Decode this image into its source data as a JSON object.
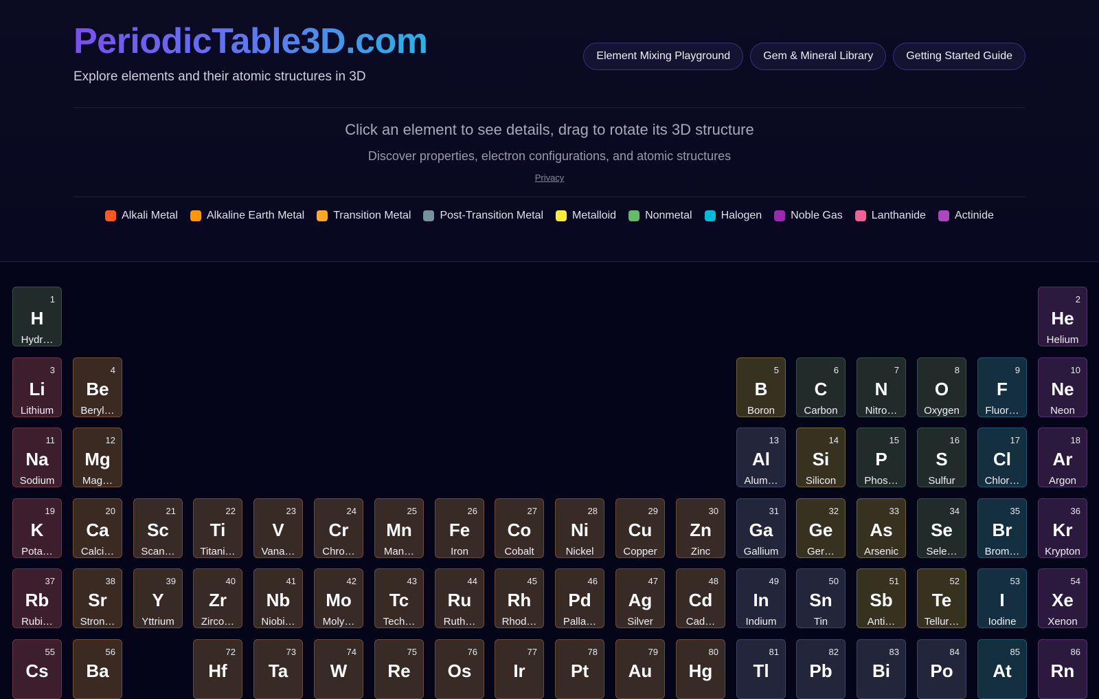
{
  "header": {
    "brand": "PeriodicTable3D.com",
    "tagline": "Explore elements and their atomic structures in 3D",
    "nav": [
      "Element Mixing Playground",
      "Gem & Mineral Library",
      "Getting Started Guide"
    ]
  },
  "instructions": {
    "main": "Click an element to see details, drag to rotate its 3D structure",
    "sub": "Discover properties, electron configurations, and atomic structures",
    "privacy": "Privacy"
  },
  "legend": [
    {
      "label": "Alkali Metal",
      "color": "#ff5722"
    },
    {
      "label": "Alkaline Earth Metal",
      "color": "#ff9800"
    },
    {
      "label": "Transition Metal",
      "color": "#ffa726"
    },
    {
      "label": "Post-Transition Metal",
      "color": "#78909c"
    },
    {
      "label": "Metalloid",
      "color": "#ffeb3b"
    },
    {
      "label": "Nonmetal",
      "color": "#66bb6a"
    },
    {
      "label": "Halogen",
      "color": "#00bcd4"
    },
    {
      "label": "Noble Gas",
      "color": "#9c27b0"
    },
    {
      "label": "Lanthanide",
      "color": "#f06292"
    },
    {
      "label": "Actinide",
      "color": "#ab47bc"
    }
  ],
  "elements": [
    {
      "n": "1",
      "s": "H",
      "name": "Hydr…",
      "cat": "nonmetal",
      "row": 0,
      "col": 0
    },
    {
      "n": "2",
      "s": "He",
      "name": "Helium",
      "cat": "noble",
      "row": 0,
      "col": 17
    },
    {
      "n": "3",
      "s": "Li",
      "name": "Lithium",
      "cat": "alkali",
      "row": 1,
      "col": 0
    },
    {
      "n": "4",
      "s": "Be",
      "name": "Beryl…",
      "cat": "alkaline",
      "row": 1,
      "col": 1
    },
    {
      "n": "5",
      "s": "B",
      "name": "Boron",
      "cat": "metalloid",
      "row": 1,
      "col": 12
    },
    {
      "n": "6",
      "s": "C",
      "name": "Carbon",
      "cat": "nonmetal",
      "row": 1,
      "col": 13
    },
    {
      "n": "7",
      "s": "N",
      "name": "Nitro…",
      "cat": "nonmetal",
      "row": 1,
      "col": 14
    },
    {
      "n": "8",
      "s": "O",
      "name": "Oxygen",
      "cat": "nonmetal",
      "row": 1,
      "col": 15
    },
    {
      "n": "9",
      "s": "F",
      "name": "Fluor…",
      "cat": "halogen",
      "row": 1,
      "col": 16
    },
    {
      "n": "10",
      "s": "Ne",
      "name": "Neon",
      "cat": "noble",
      "row": 1,
      "col": 17
    },
    {
      "n": "11",
      "s": "Na",
      "name": "Sodium",
      "cat": "alkali",
      "row": 2,
      "col": 0
    },
    {
      "n": "12",
      "s": "Mg",
      "name": "Mag…",
      "cat": "alkaline",
      "row": 2,
      "col": 1
    },
    {
      "n": "13",
      "s": "Al",
      "name": "Alum…",
      "cat": "post",
      "row": 2,
      "col": 12
    },
    {
      "n": "14",
      "s": "Si",
      "name": "Silicon",
      "cat": "metalloid",
      "row": 2,
      "col": 13
    },
    {
      "n": "15",
      "s": "P",
      "name": "Phos…",
      "cat": "nonmetal",
      "row": 2,
      "col": 14
    },
    {
      "n": "16",
      "s": "S",
      "name": "Sulfur",
      "cat": "nonmetal",
      "row": 2,
      "col": 15
    },
    {
      "n": "17",
      "s": "Cl",
      "name": "Chlor…",
      "cat": "halogen",
      "row": 2,
      "col": 16
    },
    {
      "n": "18",
      "s": "Ar",
      "name": "Argon",
      "cat": "noble",
      "row": 2,
      "col": 17
    },
    {
      "n": "19",
      "s": "K",
      "name": "Pota…",
      "cat": "alkali",
      "row": 3,
      "col": 0
    },
    {
      "n": "20",
      "s": "Ca",
      "name": "Calci…",
      "cat": "alkaline",
      "row": 3,
      "col": 1
    },
    {
      "n": "21",
      "s": "Sc",
      "name": "Scan…",
      "cat": "transition",
      "row": 3,
      "col": 2
    },
    {
      "n": "22",
      "s": "Ti",
      "name": "Titani…",
      "cat": "transition",
      "row": 3,
      "col": 3
    },
    {
      "n": "23",
      "s": "V",
      "name": "Vana…",
      "cat": "transition",
      "row": 3,
      "col": 4
    },
    {
      "n": "24",
      "s": "Cr",
      "name": "Chro…",
      "cat": "transition",
      "row": 3,
      "col": 5
    },
    {
      "n": "25",
      "s": "Mn",
      "name": "Man…",
      "cat": "transition",
      "row": 3,
      "col": 6
    },
    {
      "n": "26",
      "s": "Fe",
      "name": "Iron",
      "cat": "transition",
      "row": 3,
      "col": 7
    },
    {
      "n": "27",
      "s": "Co",
      "name": "Cobalt",
      "cat": "transition",
      "row": 3,
      "col": 8
    },
    {
      "n": "28",
      "s": "Ni",
      "name": "Nickel",
      "cat": "transition",
      "row": 3,
      "col": 9
    },
    {
      "n": "29",
      "s": "Cu",
      "name": "Copper",
      "cat": "transition",
      "row": 3,
      "col": 10
    },
    {
      "n": "30",
      "s": "Zn",
      "name": "Zinc",
      "cat": "transition",
      "row": 3,
      "col": 11
    },
    {
      "n": "31",
      "s": "Ga",
      "name": "Gallium",
      "cat": "post",
      "row": 3,
      "col": 12
    },
    {
      "n": "32",
      "s": "Ge",
      "name": "Ger…",
      "cat": "metalloid",
      "row": 3,
      "col": 13
    },
    {
      "n": "33",
      "s": "As",
      "name": "Arsenic",
      "cat": "metalloid",
      "row": 3,
      "col": 14
    },
    {
      "n": "34",
      "s": "Se",
      "name": "Sele…",
      "cat": "nonmetal",
      "row": 3,
      "col": 15
    },
    {
      "n": "35",
      "s": "Br",
      "name": "Brom…",
      "cat": "halogen",
      "row": 3,
      "col": 16
    },
    {
      "n": "36",
      "s": "Kr",
      "name": "Krypton",
      "cat": "noble",
      "row": 3,
      "col": 17
    },
    {
      "n": "37",
      "s": "Rb",
      "name": "Rubi…",
      "cat": "alkali",
      "row": 4,
      "col": 0
    },
    {
      "n": "38",
      "s": "Sr",
      "name": "Stron…",
      "cat": "alkaline",
      "row": 4,
      "col": 1
    },
    {
      "n": "39",
      "s": "Y",
      "name": "Yttrium",
      "cat": "transition",
      "row": 4,
      "col": 2
    },
    {
      "n": "40",
      "s": "Zr",
      "name": "Zirco…",
      "cat": "transition",
      "row": 4,
      "col": 3
    },
    {
      "n": "41",
      "s": "Nb",
      "name": "Niobi…",
      "cat": "transition",
      "row": 4,
      "col": 4
    },
    {
      "n": "42",
      "s": "Mo",
      "name": "Moly…",
      "cat": "transition",
      "row": 4,
      "col": 5
    },
    {
      "n": "43",
      "s": "Tc",
      "name": "Tech…",
      "cat": "transition",
      "row": 4,
      "col": 6
    },
    {
      "n": "44",
      "s": "Ru",
      "name": "Ruth…",
      "cat": "transition",
      "row": 4,
      "col": 7
    },
    {
      "n": "45",
      "s": "Rh",
      "name": "Rhod…",
      "cat": "transition",
      "row": 4,
      "col": 8
    },
    {
      "n": "46",
      "s": "Pd",
      "name": "Palla…",
      "cat": "transition",
      "row": 4,
      "col": 9
    },
    {
      "n": "47",
      "s": "Ag",
      "name": "Silver",
      "cat": "transition",
      "row": 4,
      "col": 10
    },
    {
      "n": "48",
      "s": "Cd",
      "name": "Cad…",
      "cat": "transition",
      "row": 4,
      "col": 11
    },
    {
      "n": "49",
      "s": "In",
      "name": "Indium",
      "cat": "post",
      "row": 4,
      "col": 12
    },
    {
      "n": "50",
      "s": "Sn",
      "name": "Tin",
      "cat": "post",
      "row": 4,
      "col": 13
    },
    {
      "n": "51",
      "s": "Sb",
      "name": "Anti…",
      "cat": "metalloid",
      "row": 4,
      "col": 14
    },
    {
      "n": "52",
      "s": "Te",
      "name": "Tellur…",
      "cat": "metalloid",
      "row": 4,
      "col": 15
    },
    {
      "n": "53",
      "s": "I",
      "name": "Iodine",
      "cat": "halogen",
      "row": 4,
      "col": 16
    },
    {
      "n": "54",
      "s": "Xe",
      "name": "Xenon",
      "cat": "noble",
      "row": 4,
      "col": 17
    },
    {
      "n": "55",
      "s": "Cs",
      "name": "",
      "cat": "alkali",
      "row": 5,
      "col": 0
    },
    {
      "n": "56",
      "s": "Ba",
      "name": "",
      "cat": "alkaline",
      "row": 5,
      "col": 1
    },
    {
      "n": "72",
      "s": "Hf",
      "name": "",
      "cat": "transition",
      "row": 5,
      "col": 3
    },
    {
      "n": "73",
      "s": "Ta",
      "name": "",
      "cat": "transition",
      "row": 5,
      "col": 4
    },
    {
      "n": "74",
      "s": "W",
      "name": "",
      "cat": "transition",
      "row": 5,
      "col": 5
    },
    {
      "n": "75",
      "s": "Re",
      "name": "",
      "cat": "transition",
      "row": 5,
      "col": 6
    },
    {
      "n": "76",
      "s": "Os",
      "name": "",
      "cat": "transition",
      "row": 5,
      "col": 7
    },
    {
      "n": "77",
      "s": "Ir",
      "name": "",
      "cat": "transition",
      "row": 5,
      "col": 8
    },
    {
      "n": "78",
      "s": "Pt",
      "name": "",
      "cat": "transition",
      "row": 5,
      "col": 9
    },
    {
      "n": "79",
      "s": "Au",
      "name": "",
      "cat": "transition",
      "row": 5,
      "col": 10
    },
    {
      "n": "80",
      "s": "Hg",
      "name": "",
      "cat": "transition",
      "row": 5,
      "col": 11
    },
    {
      "n": "81",
      "s": "Tl",
      "name": "",
      "cat": "post",
      "row": 5,
      "col": 12
    },
    {
      "n": "82",
      "s": "Pb",
      "name": "",
      "cat": "post",
      "row": 5,
      "col": 13
    },
    {
      "n": "83",
      "s": "Bi",
      "name": "",
      "cat": "post",
      "row": 5,
      "col": 14
    },
    {
      "n": "84",
      "s": "Po",
      "name": "",
      "cat": "post",
      "row": 5,
      "col": 15
    },
    {
      "n": "85",
      "s": "At",
      "name": "",
      "cat": "halogen",
      "row": 5,
      "col": 16
    },
    {
      "n": "86",
      "s": "Rn",
      "name": "",
      "cat": "noble",
      "row": 5,
      "col": 17
    }
  ]
}
